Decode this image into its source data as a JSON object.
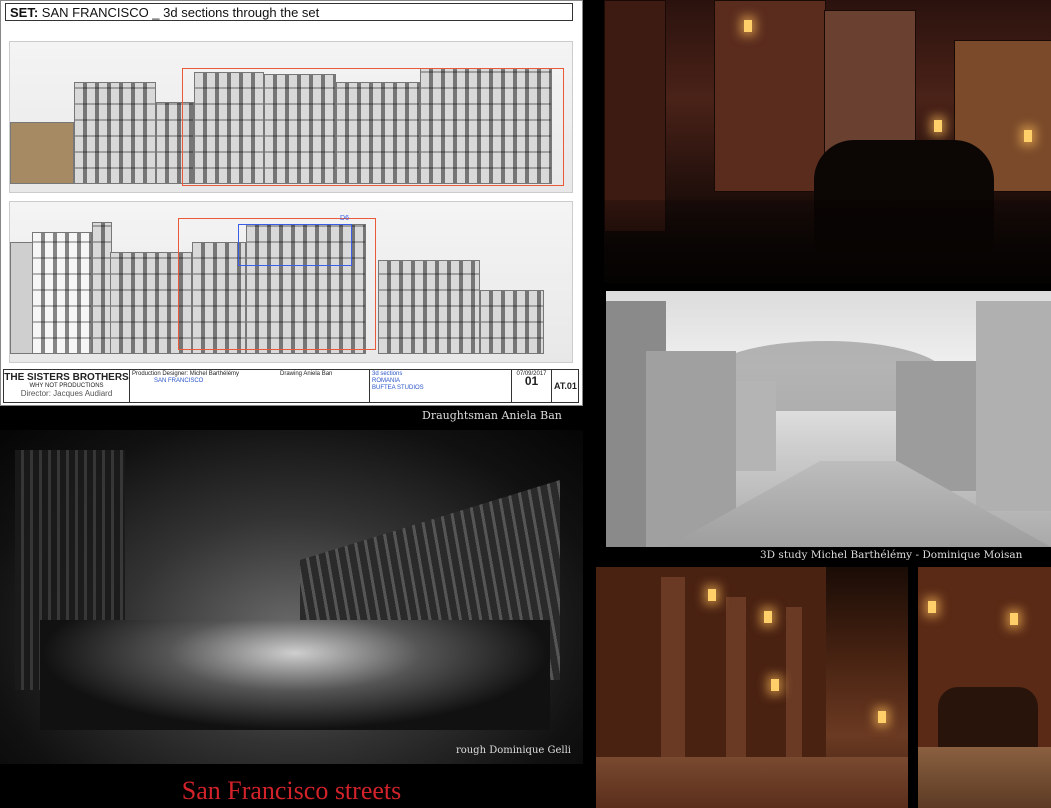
{
  "sheet": {
    "title_prefix": "SET:",
    "title_text": "SAN FRANCISCO _ 3d sections through the set",
    "production": "THE SISTERS BROTHERS",
    "company": "WHY NOT PRODUCTIONS",
    "director": "Director: Jacques Audiard",
    "designer": "Production Designer: Michel Barthélémy",
    "drawing": "Drawing Aniela Ban",
    "set_label": "SAN FRANCISCO",
    "subject": "3d sections",
    "country": "ROMANIA",
    "studio": "BUFTEA STUDIOS",
    "date": "07/09/2017",
    "page": "01",
    "code": "AT.01",
    "box_marker": "D6"
  },
  "captions": {
    "draughtsman": "Draughtsman Aniela Ban",
    "study": "3D study Michel Barthélémy - Dominique Moisan",
    "rough": "rough Dominique Gelli"
  },
  "footer": {
    "title": "San Francisco streets"
  },
  "colors": {
    "title_red": "#d2222a",
    "outline_red": "#e85a3a",
    "outline_blue": "#3a5ee8"
  }
}
